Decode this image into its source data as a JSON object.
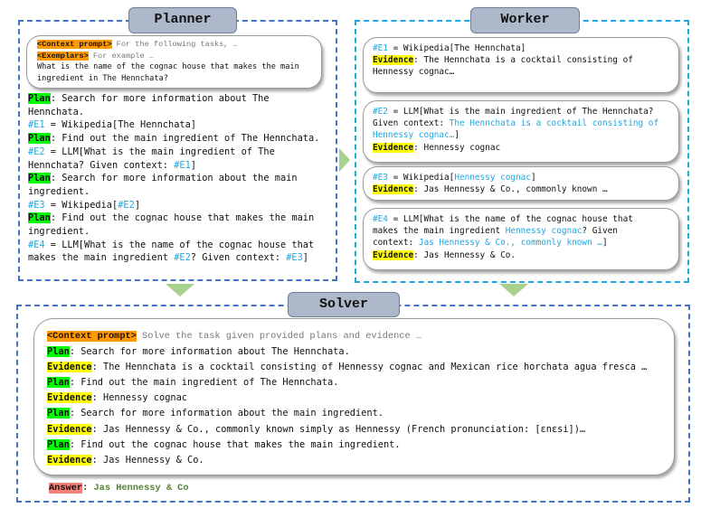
{
  "colors": {
    "planner_border": "#4472c4",
    "worker_border": "#1ea7e1",
    "plan_highlight": "#00ff00",
    "evidence_highlight": "#ffff00",
    "context_highlight": "#ff9900",
    "answer_highlight": "#f4807a",
    "reference": "#1ea7e1",
    "arrow": "#a9d18e"
  },
  "planner": {
    "title": "Planner",
    "prompt_card": [
      [
        {
          "t": "<Context prompt>",
          "s": "ctx"
        },
        {
          "t": " For the following tasks, …",
          "s": "gray"
        }
      ],
      [
        {
          "t": "<Exemplars>",
          "s": "ctx"
        },
        {
          "t": " For example …",
          "s": "gray"
        }
      ],
      [
        {
          "t": "What is the name of the cognac house that makes the main",
          "s": ""
        }
      ],
      [
        {
          "t": "ingredient in The Hennchata?",
          "s": ""
        }
      ]
    ],
    "lines": [
      [
        {
          "t": "Plan",
          "s": "plan"
        },
        {
          "t": ": Search for more information about The",
          "s": ""
        }
      ],
      [
        {
          "t": "Hennchata.",
          "s": ""
        }
      ],
      [
        {
          "t": "#E1",
          "s": "ref"
        },
        {
          "t": " = Wikipedia[The Hennchata]",
          "s": ""
        }
      ],
      [
        {
          "t": "Plan",
          "s": "plan"
        },
        {
          "t": ": Find out the main ingredient of The Hennchata.",
          "s": ""
        }
      ],
      [
        {
          "t": "#E2",
          "s": "ref"
        },
        {
          "t": " = LLM[What is the main ingredient of The",
          "s": ""
        }
      ],
      [
        {
          "t": "Hennchata? Given context: ",
          "s": ""
        },
        {
          "t": "#E1",
          "s": "ref"
        },
        {
          "t": "]",
          "s": ""
        }
      ],
      [
        {
          "t": "Plan",
          "s": "plan"
        },
        {
          "t": ": Search for more information about the main",
          "s": ""
        }
      ],
      [
        {
          "t": "ingredient.",
          "s": ""
        }
      ],
      [
        {
          "t": "#E3",
          "s": "ref"
        },
        {
          "t": " = Wikipedia[",
          "s": ""
        },
        {
          "t": "#E2",
          "s": "ref"
        },
        {
          "t": "]",
          "s": ""
        }
      ],
      [
        {
          "t": "Plan",
          "s": "plan"
        },
        {
          "t": ": Find out the cognac house that makes the main",
          "s": ""
        }
      ],
      [
        {
          "t": "ingredient.",
          "s": ""
        }
      ],
      [
        {
          "t": "#E4",
          "s": "ref"
        },
        {
          "t": " = LLM[What is the name of the cognac house that",
          "s": ""
        }
      ],
      [
        {
          "t": "makes the main ingredient ",
          "s": ""
        },
        {
          "t": "#E2",
          "s": "ref"
        },
        {
          "t": "? Given context: ",
          "s": ""
        },
        {
          "t": "#E3",
          "s": "ref"
        },
        {
          "t": "]",
          "s": ""
        }
      ]
    ]
  },
  "worker": {
    "title": "Worker",
    "cards": [
      [
        [
          {
            "t": "#E1",
            "s": "ref"
          },
          {
            "t": " = Wikipedia[The Hennchata]",
            "s": ""
          }
        ],
        [
          {
            "t": "Evidence",
            "s": "ev"
          },
          {
            "t": ": The Hennchata is a cocktail consisting of",
            "s": ""
          }
        ],
        [
          {
            "t": "Hennessy cognac…",
            "s": ""
          }
        ]
      ],
      [
        [
          {
            "t": "#E2",
            "s": "ref"
          },
          {
            "t": " = LLM[What is the main ingredient of The Hennchata?",
            "s": ""
          }
        ],
        [
          {
            "t": "Given context: ",
            "s": ""
          },
          {
            "t": "The Hennchata is a cocktail consisting of",
            "s": "ref"
          }
        ],
        [
          {
            "t": "Hennessy cognac…",
            "s": "ref"
          },
          {
            "t": "]",
            "s": ""
          }
        ],
        [
          {
            "t": "Evidence",
            "s": "ev"
          },
          {
            "t": ": Hennessy cognac",
            "s": ""
          }
        ]
      ],
      [
        [
          {
            "t": "#E3",
            "s": "ref"
          },
          {
            "t": " = Wikipedia[",
            "s": ""
          },
          {
            "t": "Hennessy cognac",
            "s": "ref"
          },
          {
            "t": "]",
            "s": ""
          }
        ],
        [
          {
            "t": "Evidence",
            "s": "ev"
          },
          {
            "t": ": Jas Hennessy & Co., commonly known …",
            "s": ""
          }
        ]
      ],
      [
        [
          {
            "t": "#E4",
            "s": "ref"
          },
          {
            "t": " = LLM[What is the name of the cognac house that",
            "s": ""
          }
        ],
        [
          {
            "t": "makes the main ingredient ",
            "s": ""
          },
          {
            "t": "Hennessy cognac",
            "s": "ref"
          },
          {
            "t": "? Given",
            "s": ""
          }
        ],
        [
          {
            "t": "context: ",
            "s": ""
          },
          {
            "t": "Jas Hennessy & Co., commonly known …",
            "s": "ref"
          },
          {
            "t": "]",
            "s": ""
          }
        ],
        [
          {
            "t": "Evidence",
            "s": "ev"
          },
          {
            "t": ": Jas Hennessy & Co.",
            "s": ""
          }
        ]
      ]
    ]
  },
  "solver": {
    "title": "Solver",
    "lines": [
      [
        {
          "t": "<Context prompt>",
          "s": "ctx"
        },
        {
          "t": " Solve the task given provided plans and evidence …",
          "s": "gray"
        }
      ],
      [
        {
          "t": "Plan",
          "s": "plan"
        },
        {
          "t": ": Search for more information about The Hennchata.",
          "s": ""
        }
      ],
      [
        {
          "t": "Evidence",
          "s": "ev"
        },
        {
          "t": ": The Hennchata is a cocktail consisting of Hennessy cognac and Mexican rice horchata agua fresca …",
          "s": ""
        }
      ],
      [
        {
          "t": "Plan",
          "s": "plan"
        },
        {
          "t": ": Find out the main ingredient of The Hennchata.",
          "s": ""
        }
      ],
      [
        {
          "t": "Evidence",
          "s": "ev"
        },
        {
          "t": ": Hennessy cognac",
          "s": ""
        }
      ],
      [
        {
          "t": "Plan",
          "s": "plan"
        },
        {
          "t": ": Search for more information about the main ingredient.",
          "s": ""
        }
      ],
      [
        {
          "t": "Evidence",
          "s": "ev"
        },
        {
          "t": ": Jas Hennessy & Co., commonly known simply as Hennessy (French pronunciation: [ɛnɛsi])…",
          "s": ""
        }
      ],
      [
        {
          "t": "Plan",
          "s": "plan"
        },
        {
          "t": ": Find out the cognac house that makes the main ingredient.",
          "s": ""
        }
      ],
      [
        {
          "t": "Evidence",
          "s": "ev"
        },
        {
          "t": ": Jas Hennessy & Co.",
          "s": ""
        }
      ]
    ],
    "answer": [
      {
        "t": "Answer",
        "s": "ans"
      },
      {
        "t": ": ",
        "s": ""
      },
      {
        "t": "Jas Hennessy & Co",
        "s": "green"
      }
    ]
  }
}
